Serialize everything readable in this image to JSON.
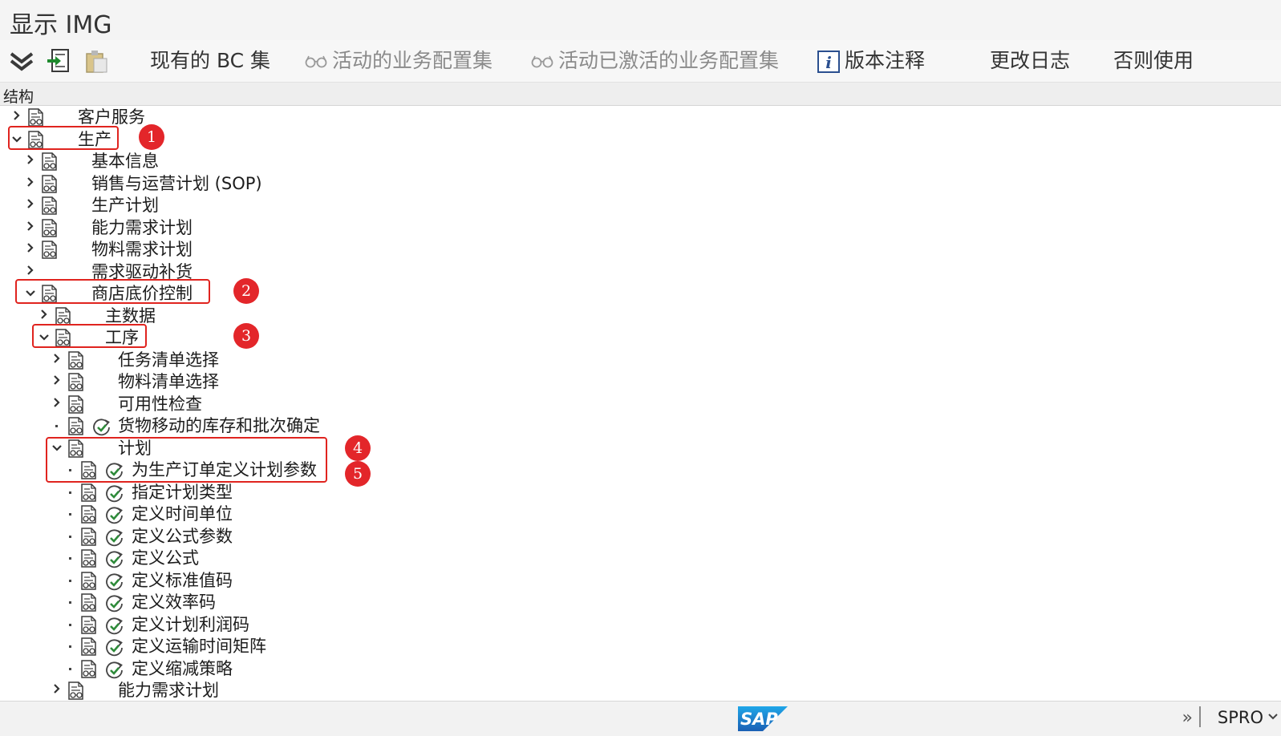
{
  "window": {
    "title": "显示 IMG"
  },
  "toolbar": {
    "buttons": [
      {
        "label": "现有的 BC 集",
        "icon": "none",
        "enabled": true
      },
      {
        "label": "活动的业务配置集",
        "icon": "glasses-icon",
        "enabled": false
      },
      {
        "label": "活动已激活的业务配置集",
        "icon": "glasses-icon",
        "enabled": false
      },
      {
        "label": "版本注释",
        "icon": "info-icon",
        "enabled": true
      },
      {
        "label": "更改日志",
        "icon": "none",
        "enabled": true
      },
      {
        "label": "否则使用",
        "icon": "none",
        "enabled": true
      }
    ]
  },
  "structure": {
    "header": "结构",
    "nodes": [
      {
        "label": "客户服务",
        "state": "collapsed"
      },
      {
        "label": "生产",
        "state": "expanded"
      },
      {
        "label": "基本信息",
        "state": "collapsed"
      },
      {
        "label": "销售与运营计划 (SOP)",
        "state": "collapsed"
      },
      {
        "label": "生产计划",
        "state": "collapsed"
      },
      {
        "label": "能力需求计划",
        "state": "collapsed"
      },
      {
        "label": "物料需求计划",
        "state": "collapsed"
      },
      {
        "label": "需求驱动补货",
        "state": "collapsed"
      },
      {
        "label": "商店底价控制",
        "state": "expanded"
      },
      {
        "label": "主数据",
        "state": "collapsed"
      },
      {
        "label": "工序",
        "state": "expanded"
      },
      {
        "label": "任务清单选择",
        "state": "collapsed"
      },
      {
        "label": "物料清单选择",
        "state": "collapsed"
      },
      {
        "label": "可用性检查",
        "state": "collapsed"
      },
      {
        "label": "货物移动的库存和批次确定",
        "state": "leaf"
      },
      {
        "label": "计划",
        "state": "expanded"
      },
      {
        "label": "为生产订单定义计划参数",
        "state": "leaf"
      },
      {
        "label": "指定计划类型",
        "state": "leaf"
      },
      {
        "label": "定义时间单位",
        "state": "leaf"
      },
      {
        "label": "定义公式参数",
        "state": "leaf"
      },
      {
        "label": "定义公式",
        "state": "leaf"
      },
      {
        "label": "定义标准值码",
        "state": "leaf"
      },
      {
        "label": "定义效率码",
        "state": "leaf"
      },
      {
        "label": "定义计划利润码",
        "state": "leaf"
      },
      {
        "label": "定义运输时间矩阵",
        "state": "leaf"
      },
      {
        "label": "定义缩减策略",
        "state": "leaf"
      },
      {
        "label": "能力需求计划",
        "state": "collapsed"
      }
    ]
  },
  "annotations": [
    "1",
    "2",
    "3",
    "4",
    "5"
  ],
  "statusbar": {
    "logo": "SAP",
    "more": "»",
    "transaction": "SPRO"
  },
  "colors": {
    "highlight": "#e0241f",
    "activity_green": "#2e8b3a",
    "sap_blue": "#1a73c8"
  }
}
